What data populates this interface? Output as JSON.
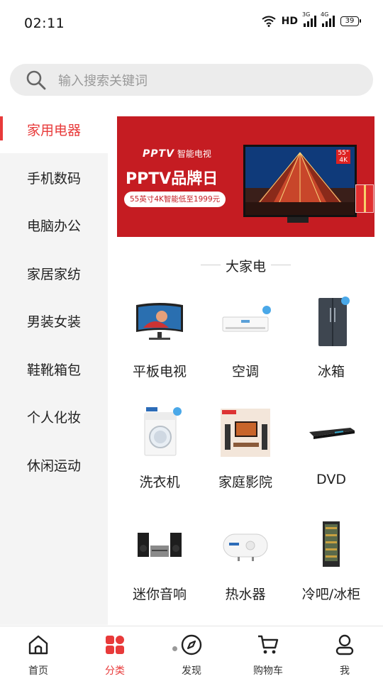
{
  "status": {
    "time": "02:11",
    "hd": "HD",
    "net1": "3G",
    "net2": "4G",
    "battery": "39"
  },
  "search": {
    "placeholder": "输入搜索关键词"
  },
  "sidebar": {
    "items": [
      {
        "label": "家用电器",
        "active": true
      },
      {
        "label": "手机数码"
      },
      {
        "label": "电脑办公"
      },
      {
        "label": "家居家纺"
      },
      {
        "label": "男装女装"
      },
      {
        "label": "鞋靴箱包"
      },
      {
        "label": "个人化妆"
      },
      {
        "label": "休闲运动"
      }
    ]
  },
  "banner": {
    "brand": "PPTV",
    "brand_sub": "智能电视",
    "title": "PPTV品牌日",
    "promo": "55英寸4K智能低至1999元",
    "tv_size": "55\"",
    "tv_res": "4K"
  },
  "section": {
    "title": "大家电"
  },
  "products": [
    {
      "label": "平板电视",
      "icon": "monitor-icon"
    },
    {
      "label": "空调",
      "icon": "air-conditioner-icon"
    },
    {
      "label": "冰箱",
      "icon": "fridge-icon"
    },
    {
      "label": "洗衣机",
      "icon": "washing-machine-icon"
    },
    {
      "label": "家庭影院",
      "icon": "home-theater-icon"
    },
    {
      "label": "DVD",
      "icon": "dvd-player-icon"
    },
    {
      "label": "迷你音响",
      "icon": "mini-speaker-icon"
    },
    {
      "label": "热水器",
      "icon": "water-heater-icon"
    },
    {
      "label": "冷吧/冰柜",
      "icon": "wine-cooler-icon"
    }
  ],
  "nav": {
    "items": [
      {
        "label": "首页",
        "icon": "home-icon"
      },
      {
        "label": "分类",
        "icon": "category-icon",
        "active": true
      },
      {
        "label": "发现",
        "icon": "compass-icon"
      },
      {
        "label": "购物车",
        "icon": "cart-icon"
      },
      {
        "label": "我",
        "icon": "user-icon"
      }
    ]
  },
  "colors": {
    "accent": "#e83a3a",
    "banner_bg": "#c51c22",
    "sidebar_bg": "#f4f4f4",
    "search_bg": "#ececec"
  }
}
